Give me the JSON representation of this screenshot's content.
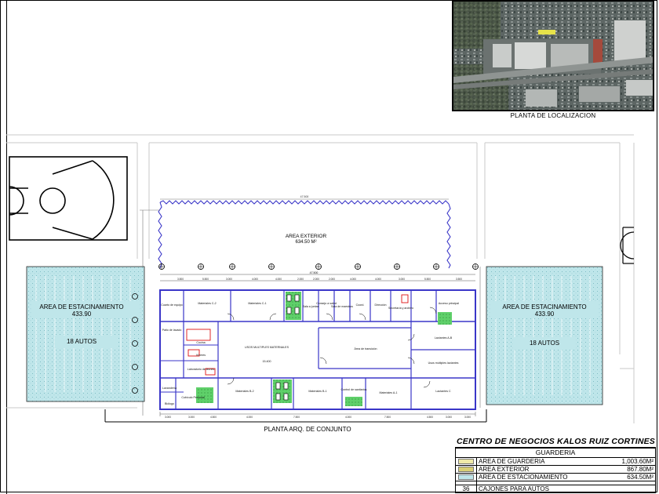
{
  "location_plan": {
    "caption": "PLANTA DE LOCALIZACION"
  },
  "plan": {
    "caption": "PLANTA ARQ. DE CONJUNTO",
    "exterior_area": {
      "label": "AREA EXTERIOR",
      "value": "634.50 M²",
      "dimension": "47.500"
    },
    "left_parking": {
      "label": "AREA DE ESTACINAMIENTO",
      "value": "433.90",
      "cars": "18 AUTOS"
    },
    "right_parking": {
      "label": "AREA DE ESTACINAMIENTO",
      "value": "433.90",
      "cars": "18 AUTOS"
    },
    "top_dimension_total": "47.500",
    "top_dimensions": [
      "3.500",
      "5.500",
      "3.000",
      "4.000",
      "4.000",
      "2.000",
      "2.000",
      "2.000",
      "4.000",
      "4.000",
      "3.000",
      "5.500",
      "3.500"
    ],
    "bottom_dimensions": [
      "3.000",
      "3.000",
      "4.500",
      "4.000",
      "7.500",
      "7.500",
      "4.000",
      "4.500",
      "3.000",
      "3.000"
    ],
    "rooms": {
      "cuarto_equipo": "Cuarto de equipo",
      "materiales_c2": "Materiales C-2",
      "materiales_c1": "Materiales C-1",
      "sala_juntas": "Sala a juntas",
      "consejo": "Consejo a salud",
      "sala_maestros": "Sala de maestros",
      "coord": "Coord.",
      "direccion": "Dirección",
      "secretaria": "Secretaría y archivo",
      "acceso": "Acceso principal",
      "patio_lavado": "Patio de lavado",
      "cocina": "Cocina",
      "viveres": "Víveres",
      "usos_multiples": "USOS MULTIPLES MATERNALES",
      "area_transicion": "Área de transición",
      "lactantes_ab": "Lactantes A-B",
      "usos_lactantes": "Usos múltiples lactantes",
      "laboratorio": "Laboratorio de leches",
      "lavanderia": "Lavandería",
      "cubiculo": "Cubículo Personal",
      "biologo": "Biólogo",
      "materiales_b2": "Materiales B-2",
      "materiales_b1": "Materiales B-1",
      "control_sanitario": "Control de sanitarios",
      "materiales_a1": "Materiales A-1",
      "lactantes_c": "Lactantes C",
      "center_dim": "15.400"
    }
  },
  "summary": {
    "title": "CENTRO DE NEGOCIOS KALOS RUIZ CORTINES",
    "subtitle": "GUARDERIA",
    "rows": [
      {
        "label": "AREA DE GUARDERIA",
        "value": "1,003.60M²",
        "swatch": "#efe9a8"
      },
      {
        "label": "AREA EXTERIOR",
        "value": "867.80M²",
        "swatch": "#d9cf74"
      },
      {
        "label": "AREA DE ESTACIONAMIENTO",
        "value": "634.50M²",
        "swatch": "#bfe6ea"
      }
    ],
    "cars_count": "36",
    "cars_label": "CAJONES PARA AUTOS"
  },
  "colors": {
    "wall": "#3a36c8",
    "parking_fill": "#bfe6ea",
    "exterior_line": "#3a36c8",
    "green_fill": "#5fd06a"
  }
}
